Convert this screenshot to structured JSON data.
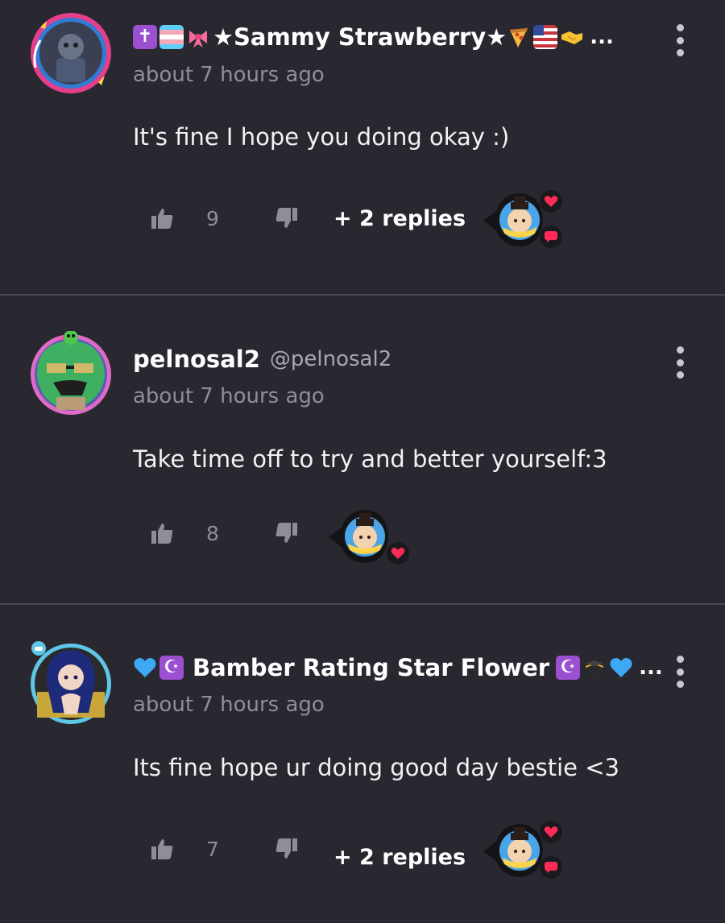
{
  "colors": {
    "background": "#29272f",
    "divider": "#4a4852",
    "muted_text": "#8f8d96",
    "heart": "#ff2a55",
    "comment_icon": "#ff2a55"
  },
  "comments": [
    {
      "display_name": "Sammy Strawberry",
      "name_prefix_icons": [
        "latin-cross-emoji",
        "transgender-flag-emoji",
        "ribbon-emoji",
        "star-glyph"
      ],
      "name_suffix_icons": [
        "star-glyph",
        "pizza-emoji",
        "us-flag-emoji",
        "handshake-emoji"
      ],
      "name_prefix_text": "★",
      "name_suffix_text": "★",
      "truncation": "...",
      "handle": "",
      "timestamp": "about 7 hours ago",
      "body": "It's fine I hope you doing okay :)",
      "likes": "9",
      "replies_label": "+ 2 replies",
      "creator_reactions": [
        "heart-icon",
        "comment-icon"
      ]
    },
    {
      "display_name": "pelnosal2",
      "handle": "@pelnosal2",
      "timestamp": "about 7 hours ago",
      "body": "Take time off to try and better yourself:3",
      "likes": "8",
      "replies_label": "",
      "creator_reactions": [
        "heart-icon"
      ]
    },
    {
      "display_name": "Bamber Rating Star Flower",
      "name_prefix_icons": [
        "blue-heart-emoji",
        "star-and-crescent-emoji"
      ],
      "name_suffix_icons": [
        "star-and-crescent-emoji",
        "kaaba-emoji",
        "blue-heart-emoji"
      ],
      "truncation": "...",
      "handle": "",
      "timestamp": "about 7 hours ago",
      "body": "Its fine hope ur doing good day bestie <3",
      "likes": "7",
      "replies_label": "+ 2 replies",
      "creator_reactions": [
        "heart-icon",
        "comment-icon"
      ]
    }
  ]
}
